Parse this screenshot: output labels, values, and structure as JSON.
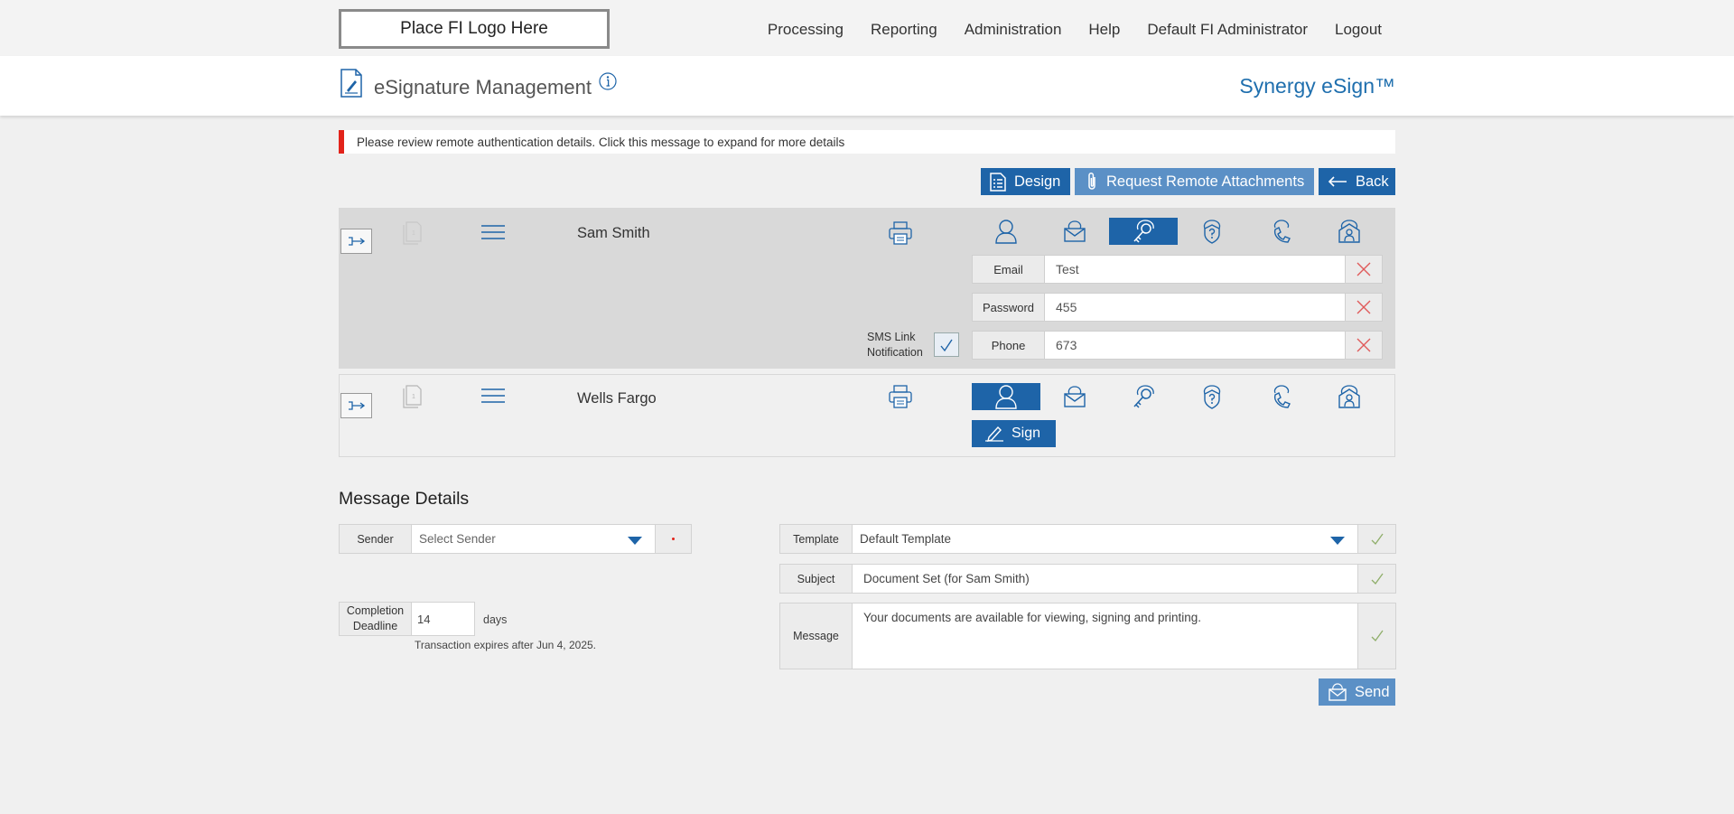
{
  "topnav": {
    "logo_text": "Place FI Logo Here",
    "items": [
      "Processing",
      "Reporting",
      "Administration",
      "Help",
      "Default FI Administrator",
      "Logout"
    ]
  },
  "header": {
    "title": "eSignature Management",
    "brand": "Synergy eSign™"
  },
  "alert": {
    "text": "Please review remote authentication details. Click this message to expand for more details",
    "color": "#e2231a"
  },
  "actions": {
    "design_label": "Design",
    "attachments_label": "Request Remote Attachments",
    "back_label": "Back"
  },
  "signers": [
    {
      "name": "Sam Smith",
      "doc_count": "1",
      "active_auth": "key-icon",
      "fields": [
        {
          "label": "Email",
          "value": "Test"
        },
        {
          "label": "Password",
          "value": "455"
        },
        {
          "label": "Phone",
          "value": "673"
        }
      ],
      "sms_label_line1": "SMS Link",
      "sms_label_line2": "Notification",
      "sms_checked": true
    },
    {
      "name": "Wells Fargo",
      "doc_count": "1",
      "active_auth": "person-icon",
      "sign_label": "Sign"
    }
  ],
  "auth_icons": [
    "person-icon",
    "mail-icon",
    "key-icon",
    "question-shield-icon",
    "phone-icon",
    "id-house-icon"
  ],
  "message_details": {
    "title": "Message Details",
    "sender_label": "Sender",
    "sender_placeholder": "Select Sender",
    "deadline_label_line1": "Completion",
    "deadline_label_line2": "Deadline",
    "deadline_value": "14",
    "days_label": "days",
    "expires_text": "Transaction expires after Jun 4, 2025.",
    "template_label": "Template",
    "template_value": "Default Template",
    "subject_label": "Subject",
    "subject_value": "Document Set (for Sam Smith)",
    "message_label": "Message",
    "message_value": "Your documents are available for viewing, signing and printing.",
    "send_label": "Send"
  },
  "colors": {
    "primary": "#1e64a8",
    "light_primary": "#5b90c6",
    "brand": "#1f6fae"
  }
}
